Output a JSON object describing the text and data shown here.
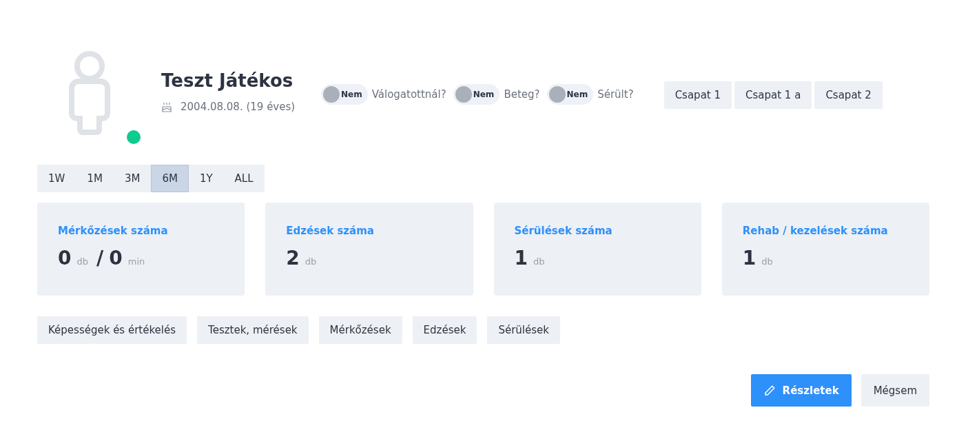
{
  "player": {
    "name": "Teszt Játékos",
    "birth": "2004.08.08. (19 éves)",
    "online": true
  },
  "flags": [
    {
      "toggle": "Nem",
      "on": false,
      "label": "Válogatottnál?"
    },
    {
      "toggle": "Nem",
      "on": false,
      "label": "Beteg?"
    },
    {
      "toggle": "Nem",
      "on": false,
      "label": "Sérült?"
    }
  ],
  "teams": [
    "Csapat 1",
    "Csapat 1 a",
    "Csapat 2"
  ],
  "periods": [
    {
      "label": "1W",
      "selected": false
    },
    {
      "label": "1M",
      "selected": false
    },
    {
      "label": "3M",
      "selected": false
    },
    {
      "label": "6M",
      "selected": true
    },
    {
      "label": "1Y",
      "selected": false
    },
    {
      "label": "ALL",
      "selected": false
    }
  ],
  "stats": [
    {
      "title": "Mérkőzések száma",
      "parts": [
        {
          "value": "0",
          "unit": "db"
        },
        {
          "value": "0",
          "unit": "min"
        }
      ],
      "separator": "/"
    },
    {
      "title": "Edzések száma",
      "parts": [
        {
          "value": "2",
          "unit": "db"
        }
      ]
    },
    {
      "title": "Sérülések száma",
      "parts": [
        {
          "value": "1",
          "unit": "db"
        }
      ]
    },
    {
      "title": "Rehab / kezelések száma",
      "parts": [
        {
          "value": "1",
          "unit": "db"
        }
      ]
    }
  ],
  "sections": [
    "Képességek és értékelés",
    "Tesztek, mérések",
    "Mérkőzések",
    "Edzések",
    "Sérülések"
  ],
  "actions": [
    {
      "kind": "primary",
      "label": "Részletek"
    },
    {
      "kind": "secondary",
      "label": "Mégsem"
    }
  ]
}
